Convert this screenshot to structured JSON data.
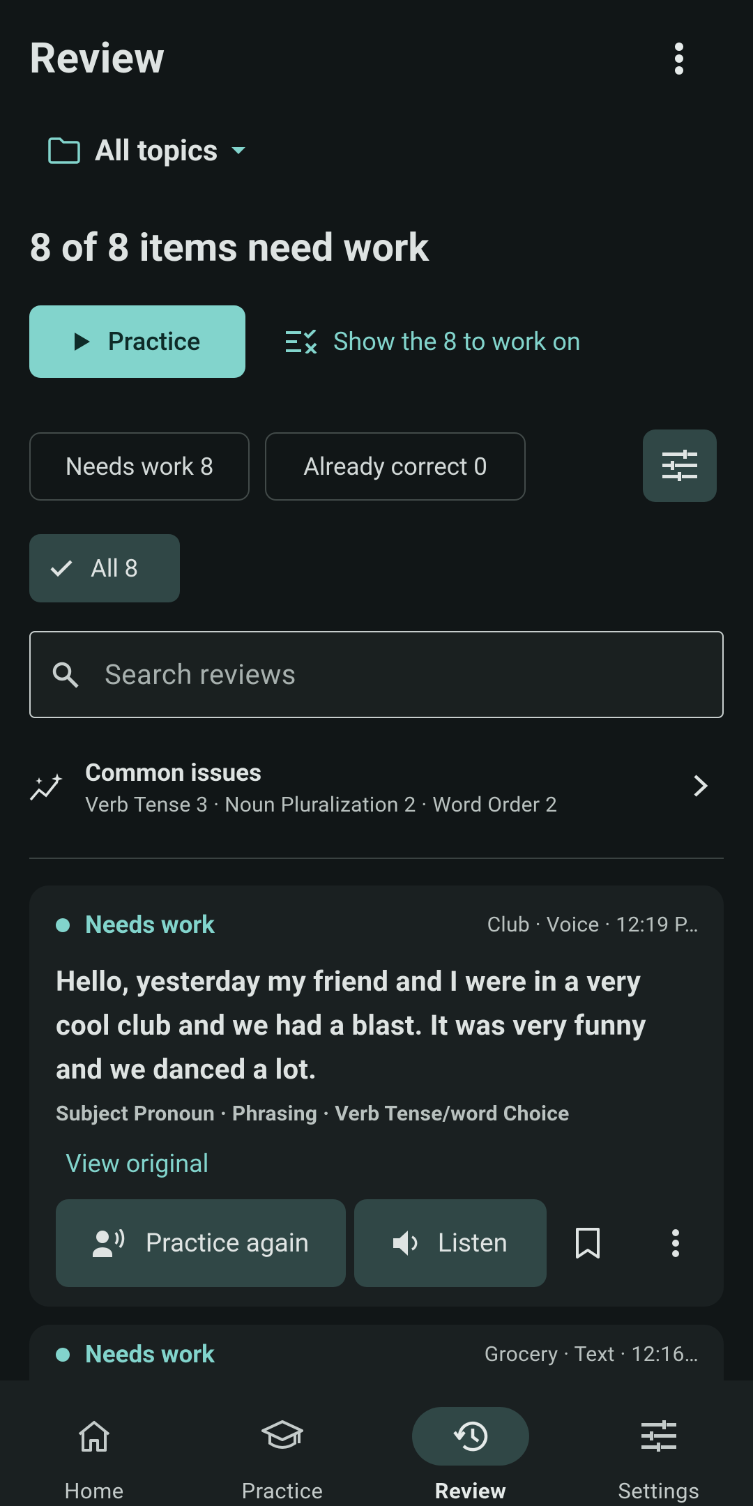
{
  "header": {
    "title": "Review",
    "more_icon": "more-vert-icon"
  },
  "topic_selector": {
    "label": "All topics",
    "icon": "folder-icon"
  },
  "summary": {
    "text": "8 of 8 items need work"
  },
  "actions": {
    "practice_label": "Practice",
    "show_label": "Show the 8 to work on"
  },
  "filters": {
    "needs_work": "Needs work 8",
    "already_correct": "Already correct 0",
    "all": "All 8"
  },
  "search": {
    "placeholder": "Search reviews",
    "value": ""
  },
  "common_issues": {
    "title": "Common issues",
    "subtitle": "Verb Tense 3 · Noun Pluralization 2 · Word Order 2"
  },
  "cards": [
    {
      "status": "Needs work",
      "meta": "Club · Voice · 12:19 P…",
      "text": "Hello, yesterday my friend and I were in a very cool club and we had a blast. It was very funny and we danced a lot.",
      "tags": "Subject Pronoun · Phrasing · Verb Tense/word Choice",
      "view_original": "View original",
      "practice_again": "Practice again",
      "listen": "Listen"
    },
    {
      "status": "Needs work",
      "meta": "Grocery · Text · 12:16…"
    }
  ],
  "nav": [
    {
      "label": "Home",
      "icon": "home-icon",
      "active": false
    },
    {
      "label": "Practice",
      "icon": "school-icon",
      "active": false
    },
    {
      "label": "Review",
      "icon": "history-icon",
      "active": true
    },
    {
      "label": "Settings",
      "icon": "tune-icon",
      "active": false
    }
  ],
  "colors": {
    "accent": "#82d4cc",
    "background": "#111617",
    "surface": "#1a2021",
    "tonal": "#304746"
  }
}
